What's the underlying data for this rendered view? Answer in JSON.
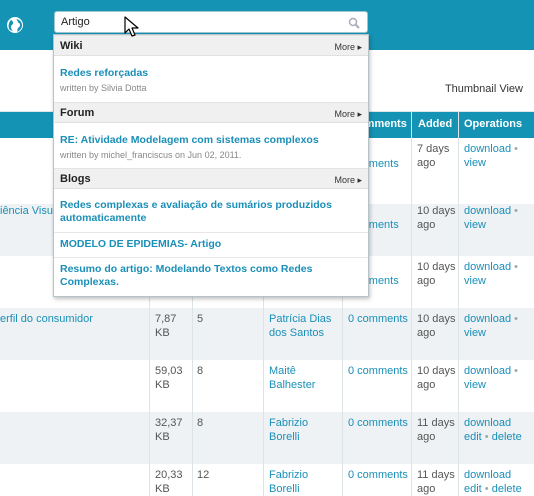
{
  "search": {
    "value": "Artigo"
  },
  "view_toggle": "Thumbnail View",
  "table": {
    "headers": [
      "Comments",
      "Added",
      "Operations"
    ],
    "rows": [
      {
        "title": "",
        "size": "",
        "count": "",
        "author": "",
        "comments": "comments",
        "added": "7 days ago",
        "ops": [
          "download",
          "view"
        ]
      },
      {
        "title": "iência Visu",
        "size": "",
        "count": "",
        "author": "",
        "comments": "comments",
        "added": "10 days ago",
        "ops": [
          "download",
          "view"
        ]
      },
      {
        "title": "",
        "size": "",
        "count": "",
        "author": "",
        "comments": "comments",
        "added": "10 days ago",
        "ops": [
          "download",
          "view"
        ]
      },
      {
        "title": "erfil do consumidor",
        "size": "7,87 KB",
        "count": "5",
        "author": "Patrícia Dias dos Santos",
        "comments": "0 comments",
        "added": "10 days ago",
        "ops": [
          "download",
          "view"
        ]
      },
      {
        "title": "",
        "size": "59,03 KB",
        "count": "8",
        "author": "Maitê Balhester",
        "comments": "0 comments",
        "added": "10 days ago",
        "ops": [
          "download",
          "view"
        ]
      },
      {
        "title": "",
        "size": "32,37 KB",
        "count": "8",
        "author": "Fabrizio Borelli",
        "comments": "0 comments",
        "added": "11 days ago",
        "ops": [
          "download",
          "edit",
          "delete"
        ]
      },
      {
        "title": "",
        "size": "20,33 KB",
        "count": "12",
        "author": "Fabrizio Borelli",
        "comments": "0 comments",
        "added": "11 days ago",
        "ops": [
          "download",
          "edit",
          "delete"
        ]
      }
    ]
  },
  "dropdown": {
    "more_label": "More ▸",
    "sections": [
      {
        "name": "Wiki",
        "items": [
          {
            "title": "Redes reforçadas",
            "sub": "written by Silvia Dotta"
          }
        ]
      },
      {
        "name": "Forum",
        "items": [
          {
            "title": "RE: Atividade Modelagem com sistemas complexos",
            "sub": "written by michel_franciscus on Jun 02, 2011."
          }
        ]
      },
      {
        "name": "Blogs",
        "items": [
          {
            "title": "Redes complexas e avaliação de sumários produzidos automaticamente",
            "sub": ""
          },
          {
            "title": "MODELO DE EPIDEMIAS- Artigo",
            "sub": ""
          },
          {
            "title": "Resumo do artigo: Modelando Textos como Redes Complexas.",
            "sub": ""
          }
        ]
      }
    ]
  }
}
